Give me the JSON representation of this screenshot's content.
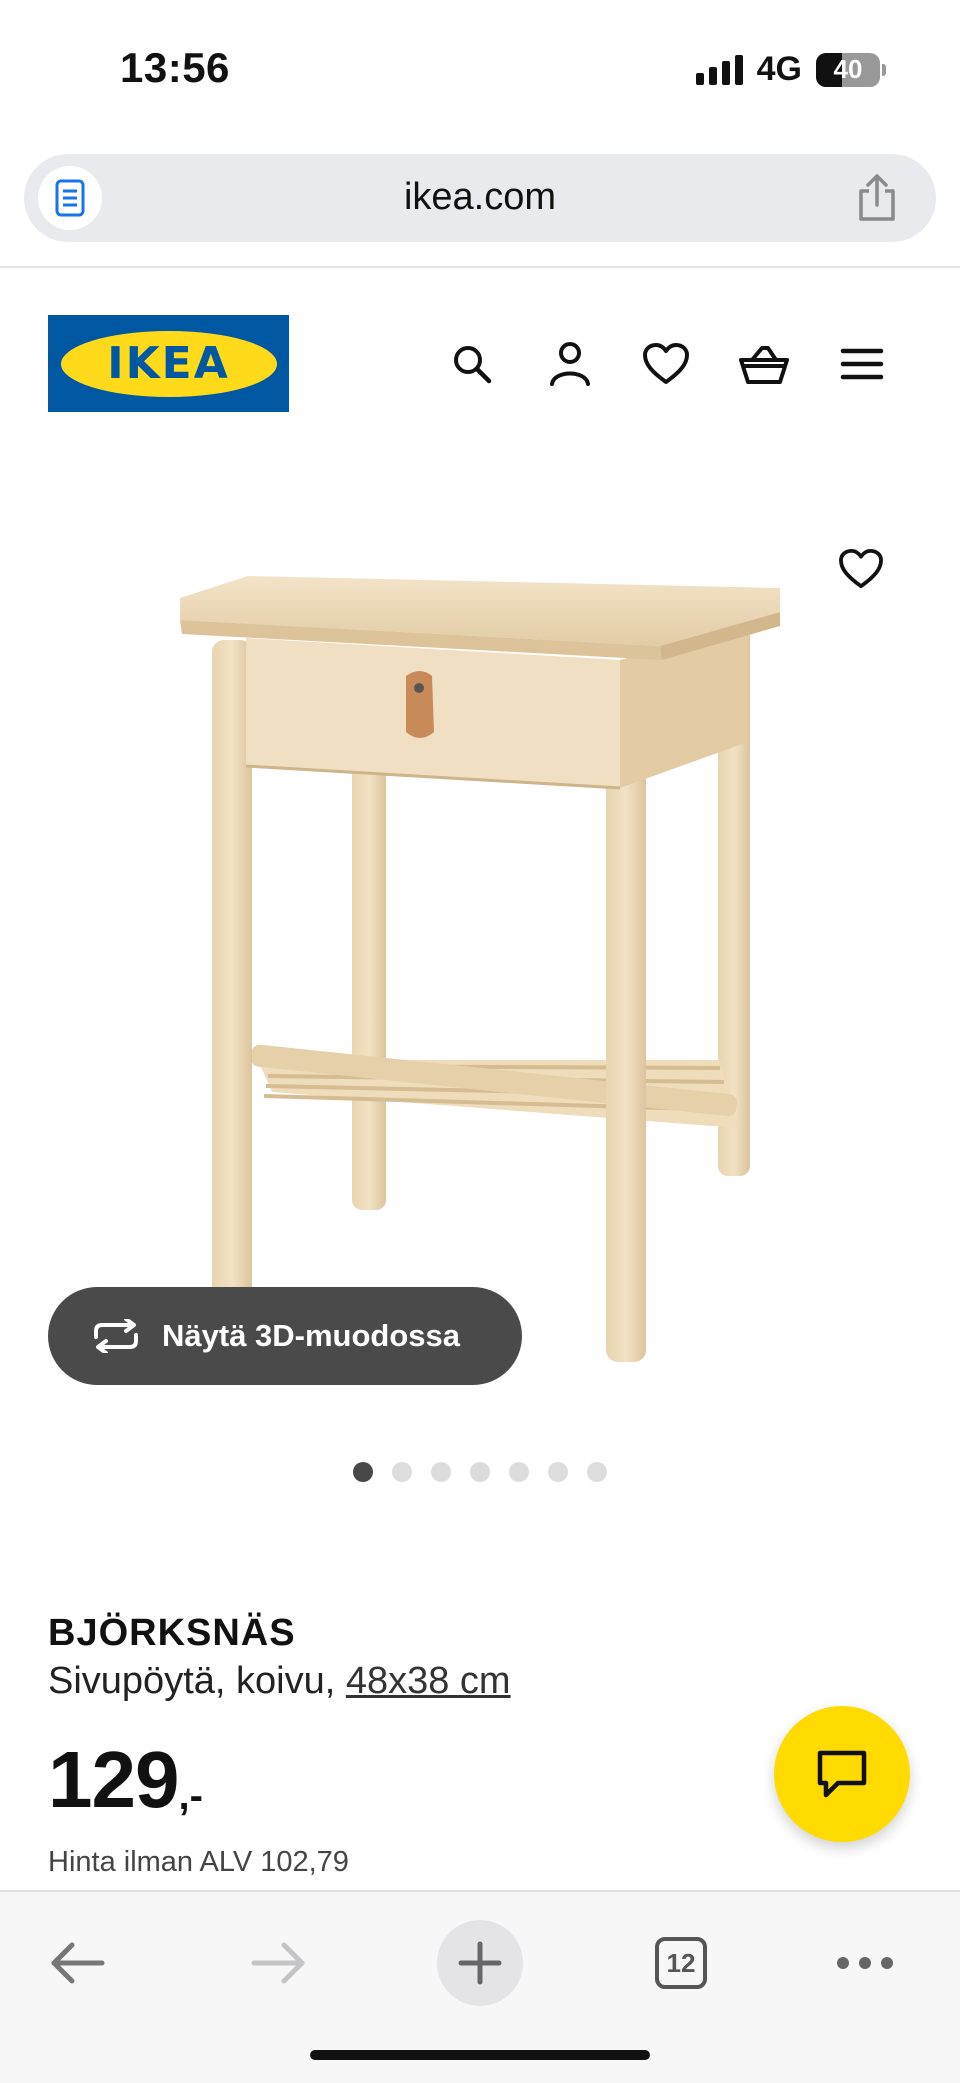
{
  "status_bar": {
    "time": "13:56",
    "network": "4G",
    "battery": "40"
  },
  "browser": {
    "url": "ikea.com",
    "tabs_count": "12"
  },
  "header": {
    "logo_text": "IKEA",
    "icons": [
      "search-icon",
      "account-icon",
      "favourites-icon",
      "basket-icon",
      "menu-icon"
    ]
  },
  "product": {
    "view_3d_label": "Näytä 3D-muodossa",
    "image_count": 7,
    "active_image_index": 0,
    "name": "BJÖRKSNÄS",
    "description": "Sivupöytä, koivu,",
    "dimensions": "48x38 cm",
    "price_int": "129",
    "price_suffix": ",-",
    "price_vat_excl": "Hinta ilman ALV 102,79"
  },
  "colors": {
    "ikea_blue": "#0058a3",
    "ikea_yellow": "#ffdb00",
    "dark_pill": "#4a4a4a"
  }
}
